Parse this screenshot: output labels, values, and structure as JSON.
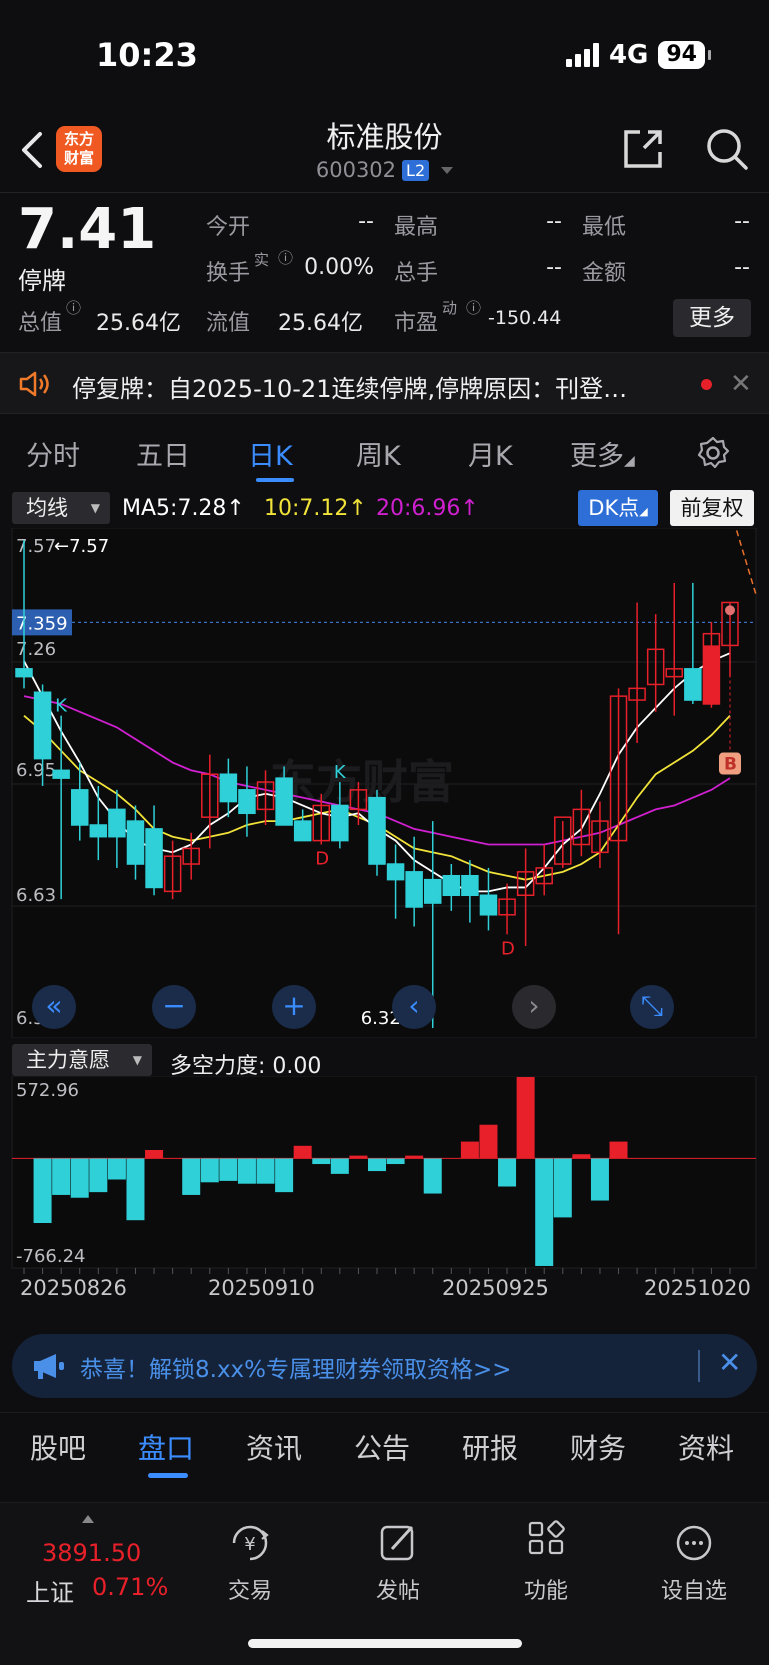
{
  "status": {
    "time": "10:23",
    "network": "4G",
    "battery": "94"
  },
  "header": {
    "logo_text_1": "东方",
    "logo_text_2": "财富",
    "stock_name": "标准股份",
    "stock_code": "600302",
    "level_badge": "L2"
  },
  "quote": {
    "price": "7.41",
    "status": "停牌",
    "fields": {
      "open_label": "今开",
      "open_value": "--",
      "high_label": "最高",
      "high_value": "--",
      "low_label": "最低",
      "low_value": "--",
      "turnover_label": "换手",
      "turnover_sup": "实",
      "turnover_value": "0.00%",
      "volume_label": "总手",
      "volume_value": "--",
      "amount_label": "金额",
      "amount_value": "--",
      "mcap_label": "总值",
      "mcap_value": "25.64亿",
      "float_label": "流值",
      "float_value": "25.64亿",
      "pe_label": "市盈",
      "pe_sup": "动",
      "pe_value": "-150.44"
    },
    "more_label": "更多"
  },
  "notice": {
    "text": "停复牌：自2025-10-21连续停牌,停牌原因：刊登…"
  },
  "period_tabs": [
    "分时",
    "五日",
    "日K",
    "周K",
    "月K",
    "更多"
  ],
  "active_period": "日K",
  "ma": {
    "select_label": "均线",
    "ma5": "MA5:7.28↑",
    "ma10": "10:7.12↑",
    "ma20": "20:6.96↑",
    "dk_label": "DK点",
    "adjust_label": "前复权"
  },
  "colors": {
    "up": "#e8202a",
    "down": "#2fd0d8",
    "ma5": "#ffffff",
    "ma10": "#f2e33a",
    "ma20": "#d020d0",
    "accent": "#3b8dff"
  },
  "chart_data": {
    "type": "candlestick",
    "y_ticks": [
      "7.57",
      "7.26",
      "6.95",
      "6.63",
      "6.32"
    ],
    "ylim": [
      6.32,
      7.57
    ],
    "high_label": "←7.57",
    "low_label": "6.32→",
    "current_line_label": "7.359",
    "x_dates": [
      "20250826",
      "20250910",
      "20250925",
      "20251020"
    ],
    "candles": [
      {
        "o": 7.24,
        "h": 7.57,
        "l": 7.19,
        "c": 7.22
      },
      {
        "o": 7.18,
        "h": 7.2,
        "l": 6.94,
        "c": 7.01
      },
      {
        "o": 6.98,
        "h": 7.12,
        "l": 6.65,
        "c": 6.96
      },
      {
        "o": 6.93,
        "h": 7.0,
        "l": 6.8,
        "c": 6.84
      },
      {
        "o": 6.84,
        "h": 6.94,
        "l": 6.75,
        "c": 6.81
      },
      {
        "o": 6.88,
        "h": 6.93,
        "l": 6.73,
        "c": 6.81
      },
      {
        "o": 6.85,
        "h": 6.89,
        "l": 6.7,
        "c": 6.74
      },
      {
        "o": 6.83,
        "h": 6.89,
        "l": 6.66,
        "c": 6.68
      },
      {
        "o": 6.67,
        "h": 6.8,
        "l": 6.65,
        "c": 6.76
      },
      {
        "o": 6.74,
        "h": 6.82,
        "l": 6.7,
        "c": 6.78
      },
      {
        "o": 6.86,
        "h": 7.02,
        "l": 6.78,
        "c": 6.97
      },
      {
        "o": 6.97,
        "h": 7.01,
        "l": 6.86,
        "c": 6.9
      },
      {
        "o": 6.93,
        "h": 6.99,
        "l": 6.81,
        "c": 6.87
      },
      {
        "o": 6.88,
        "h": 6.98,
        "l": 6.84,
        "c": 6.95
      },
      {
        "o": 6.96,
        "h": 6.99,
        "l": 6.84,
        "c": 6.84
      },
      {
        "o": 6.85,
        "h": 6.88,
        "l": 6.8,
        "c": 6.8
      },
      {
        "o": 6.8,
        "h": 6.92,
        "l": 6.79,
        "c": 6.89
      },
      {
        "o": 6.89,
        "h": 6.95,
        "l": 6.78,
        "c": 6.8
      },
      {
        "o": 6.88,
        "h": 6.95,
        "l": 6.84,
        "c": 6.93
      },
      {
        "o": 6.91,
        "h": 6.93,
        "l": 6.71,
        "c": 6.74
      },
      {
        "o": 6.74,
        "h": 6.79,
        "l": 6.6,
        "c": 6.7
      },
      {
        "o": 6.72,
        "h": 6.81,
        "l": 6.58,
        "c": 6.63
      },
      {
        "o": 6.7,
        "h": 6.85,
        "l": 6.32,
        "c": 6.64
      },
      {
        "o": 6.71,
        "h": 6.74,
        "l": 6.62,
        "c": 6.66
      },
      {
        "o": 6.71,
        "h": 6.75,
        "l": 6.59,
        "c": 6.66
      },
      {
        "o": 6.66,
        "h": 6.73,
        "l": 6.57,
        "c": 6.61
      },
      {
        "o": 6.61,
        "h": 6.69,
        "l": 6.56,
        "c": 6.65
      },
      {
        "o": 6.66,
        "h": 6.78,
        "l": 6.53,
        "c": 6.72
      },
      {
        "o": 6.69,
        "h": 6.79,
        "l": 6.66,
        "c": 6.73
      },
      {
        "o": 6.74,
        "h": 6.85,
        "l": 6.73,
        "c": 6.86
      },
      {
        "o": 6.79,
        "h": 6.93,
        "l": 6.76,
        "c": 6.88
      },
      {
        "o": 6.77,
        "h": 6.9,
        "l": 6.73,
        "c": 6.85
      },
      {
        "o": 6.8,
        "h": 7.19,
        "l": 6.56,
        "c": 7.17
      },
      {
        "o": 7.16,
        "h": 7.41,
        "l": 7.05,
        "c": 7.19
      },
      {
        "o": 7.2,
        "h": 7.38,
        "l": 7.13,
        "c": 7.29
      },
      {
        "o": 7.22,
        "h": 7.46,
        "l": 7.12,
        "c": 7.24
      },
      {
        "o": 7.24,
        "h": 7.46,
        "l": 7.15,
        "c": 7.16
      },
      {
        "o": 7.15,
        "h": 7.36,
        "l": 7.14,
        "c": 7.33
      },
      {
        "o": 7.3,
        "h": 7.41,
        "l": 7.22,
        "c": 7.41
      }
    ],
    "ma5": [
      7.26,
      7.17,
      7.08,
      7.0,
      6.91,
      6.85,
      6.8,
      6.78,
      6.77,
      6.79,
      6.84,
      6.87,
      6.91,
      6.92,
      6.91,
      6.89,
      6.87,
      6.86,
      6.87,
      6.83,
      6.8,
      6.75,
      6.72,
      6.69,
      6.67,
      6.67,
      6.68,
      6.68,
      6.73,
      6.79,
      6.83,
      6.92,
      7.02,
      7.09,
      7.14,
      7.19,
      7.23,
      7.26,
      7.28
    ],
    "ma10": [
      7.12,
      7.08,
      7.03,
      6.98,
      6.95,
      6.92,
      6.88,
      6.83,
      6.81,
      6.8,
      6.81,
      6.82,
      6.84,
      6.85,
      6.85,
      6.86,
      6.87,
      6.88,
      6.86,
      6.84,
      6.81,
      6.78,
      6.77,
      6.76,
      6.74,
      6.72,
      6.71,
      6.7,
      6.71,
      6.72,
      6.74,
      6.77,
      6.84,
      6.91,
      6.97,
      7.0,
      7.03,
      7.07,
      7.12
    ],
    "ma20": [
      7.17,
      7.16,
      7.15,
      7.13,
      7.11,
      7.09,
      7.06,
      7.03,
      7.0,
      6.98,
      6.97,
      6.95,
      6.94,
      6.93,
      6.92,
      6.91,
      6.9,
      6.89,
      6.88,
      6.87,
      6.85,
      6.83,
      6.82,
      6.81,
      6.8,
      6.79,
      6.79,
      6.79,
      6.79,
      6.8,
      6.81,
      6.82,
      6.84,
      6.86,
      6.88,
      6.89,
      6.91,
      6.93,
      6.96
    ],
    "markers": [
      {
        "index": 2,
        "label": "K",
        "kind": "buy"
      },
      {
        "index": 16,
        "label": "D",
        "kind": "sell"
      },
      {
        "index": 17,
        "label": "K",
        "kind": "buy"
      },
      {
        "index": 26,
        "label": "D",
        "kind": "sell"
      }
    ],
    "b_marker": "B",
    "volume_title": "主力意愿",
    "volume_value": "多空力度: 0.00",
    "volume_ylim": [
      -766.24,
      572.96
    ],
    "volume_ticks": [
      "572.96",
      "-766.24"
    ],
    "volume": [
      0,
      -460,
      -260,
      -280,
      -240,
      -150,
      -440,
      60,
      0,
      -260,
      -170,
      -160,
      -180,
      -180,
      -240,
      90,
      -40,
      -110,
      20,
      -90,
      -40,
      20,
      -250,
      0,
      120,
      240,
      -200,
      580,
      -766,
      -420,
      30,
      -300,
      120,
      0,
      0,
      0,
      0,
      0,
      0
    ]
  },
  "ctrl_buttons": [
    "«",
    "−",
    "+",
    "‹",
    "›",
    "⤡"
  ],
  "ad": {
    "text": "恭喜！解锁8.xx%专属理财券领取资格>>"
  },
  "bottom_tabs": [
    "股吧",
    "盘口",
    "资讯",
    "公告",
    "研报",
    "财务",
    "资料"
  ],
  "active_bottom_tab": "盘口",
  "bottom_nav": {
    "index_value": "3891.50",
    "index_name": "上证",
    "index_pct": "0.71%",
    "items": [
      {
        "label": "交易",
        "icon": "trade-icon"
      },
      {
        "label": "发帖",
        "icon": "post-icon"
      },
      {
        "label": "功能",
        "icon": "apps-icon"
      },
      {
        "label": "设自选",
        "icon": "watchlist-icon"
      }
    ]
  }
}
